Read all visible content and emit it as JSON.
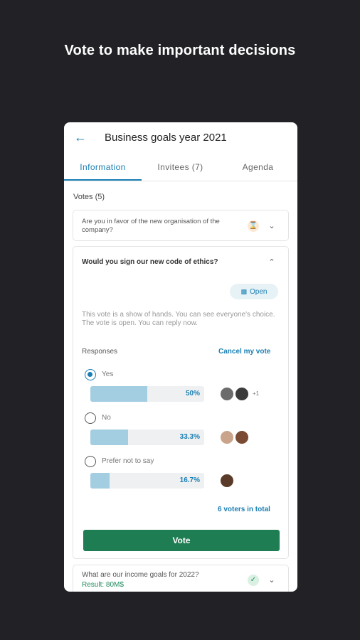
{
  "headline": "Vote to make important decisions",
  "appbar": {
    "title": "Business goals year 2021",
    "back_icon": "arrow-left-icon"
  },
  "tabs": [
    {
      "label": "Information",
      "active": true
    },
    {
      "label": "Invitees (7)",
      "active": false
    },
    {
      "label": "Agenda",
      "active": false
    }
  ],
  "votes_label": "Votes (5)",
  "votes": [
    {
      "question": "Are you in favor of the new organisation of the company?",
      "status_icon": "hourglass-icon",
      "expanded": false
    },
    {
      "question": "Would you sign our new code of ethics?",
      "expanded": true,
      "status_badge": "Open",
      "description": "This vote is a show of hands. You can see everyone's choice.\nThe vote is open. You can reply now.",
      "responses_label": "Responses",
      "cancel_label": "Cancel my vote",
      "options": [
        {
          "label": "Yes",
          "percent": 50,
          "percent_label": "50%",
          "selected": true,
          "extra_voters": "+1"
        },
        {
          "label": "No",
          "percent": 33.3,
          "percent_label": "33.3%",
          "selected": false,
          "extra_voters": ""
        },
        {
          "label": "Prefer not to say",
          "percent": 16.7,
          "percent_label": "16.7%",
          "selected": false,
          "extra_voters": ""
        }
      ],
      "total_label": "6 voters in total",
      "vote_button": "Vote"
    },
    {
      "question": "What are our income goals for 2022?",
      "result": "Result: 80M$",
      "status_icon": "check-icon",
      "expanded": false
    }
  ],
  "colors": {
    "accent": "#1b7fb3",
    "vote_button": "#1e7d53",
    "background": "#222126",
    "bar_fill": "#a3cde0"
  }
}
